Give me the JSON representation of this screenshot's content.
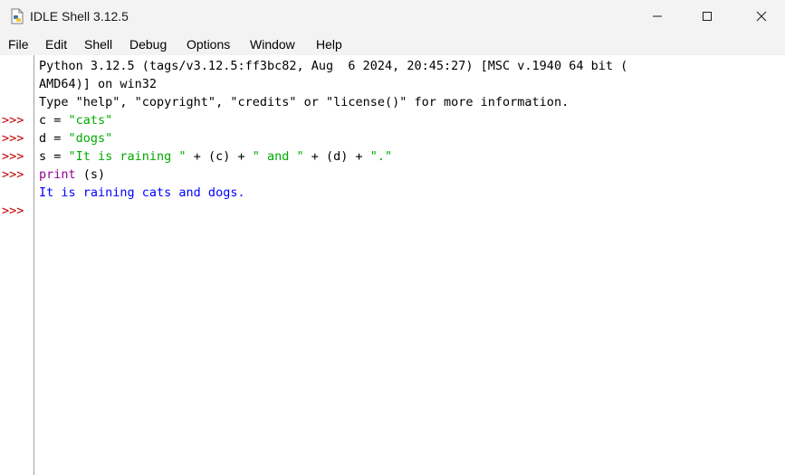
{
  "window": {
    "title": "IDLE Shell 3.12.5",
    "controls": {
      "minimize": "minimize-icon",
      "maximize": "maximize-icon",
      "close": "close-icon"
    }
  },
  "menu": {
    "items": [
      "File",
      "Edit",
      "Shell",
      "Debug",
      "Options",
      "Window",
      "Help"
    ]
  },
  "shell": {
    "banner_line1": "Python 3.12.5 (tags/v3.12.5:ff3bc82, Aug  6 2024, 20:45:27) [MSC v.1940 64 bit (",
    "banner_line2": "AMD64)] on win32",
    "banner_line3": "Type \"help\", \"copyright\", \"credits\" or \"license()\" for more information.",
    "prompt": ">>>",
    "lines": [
      {
        "code": "c = ",
        "string": "\"cats\""
      },
      {
        "code": "d = ",
        "string": "\"dogs\""
      },
      {
        "code": "s = ",
        "s1": "\"It is raining \"",
        "p1": " + (c) + ",
        "s2": "\" and \"",
        "p2": " + (d) + ",
        "s3": "\".\""
      },
      {
        "builtin": "print",
        "rest": " (s)"
      }
    ],
    "output": "It is raining cats and dogs."
  },
  "colors": {
    "prompt": "#c00000",
    "string": "#00aa00",
    "builtin": "#900090",
    "output": "#0000ff"
  }
}
